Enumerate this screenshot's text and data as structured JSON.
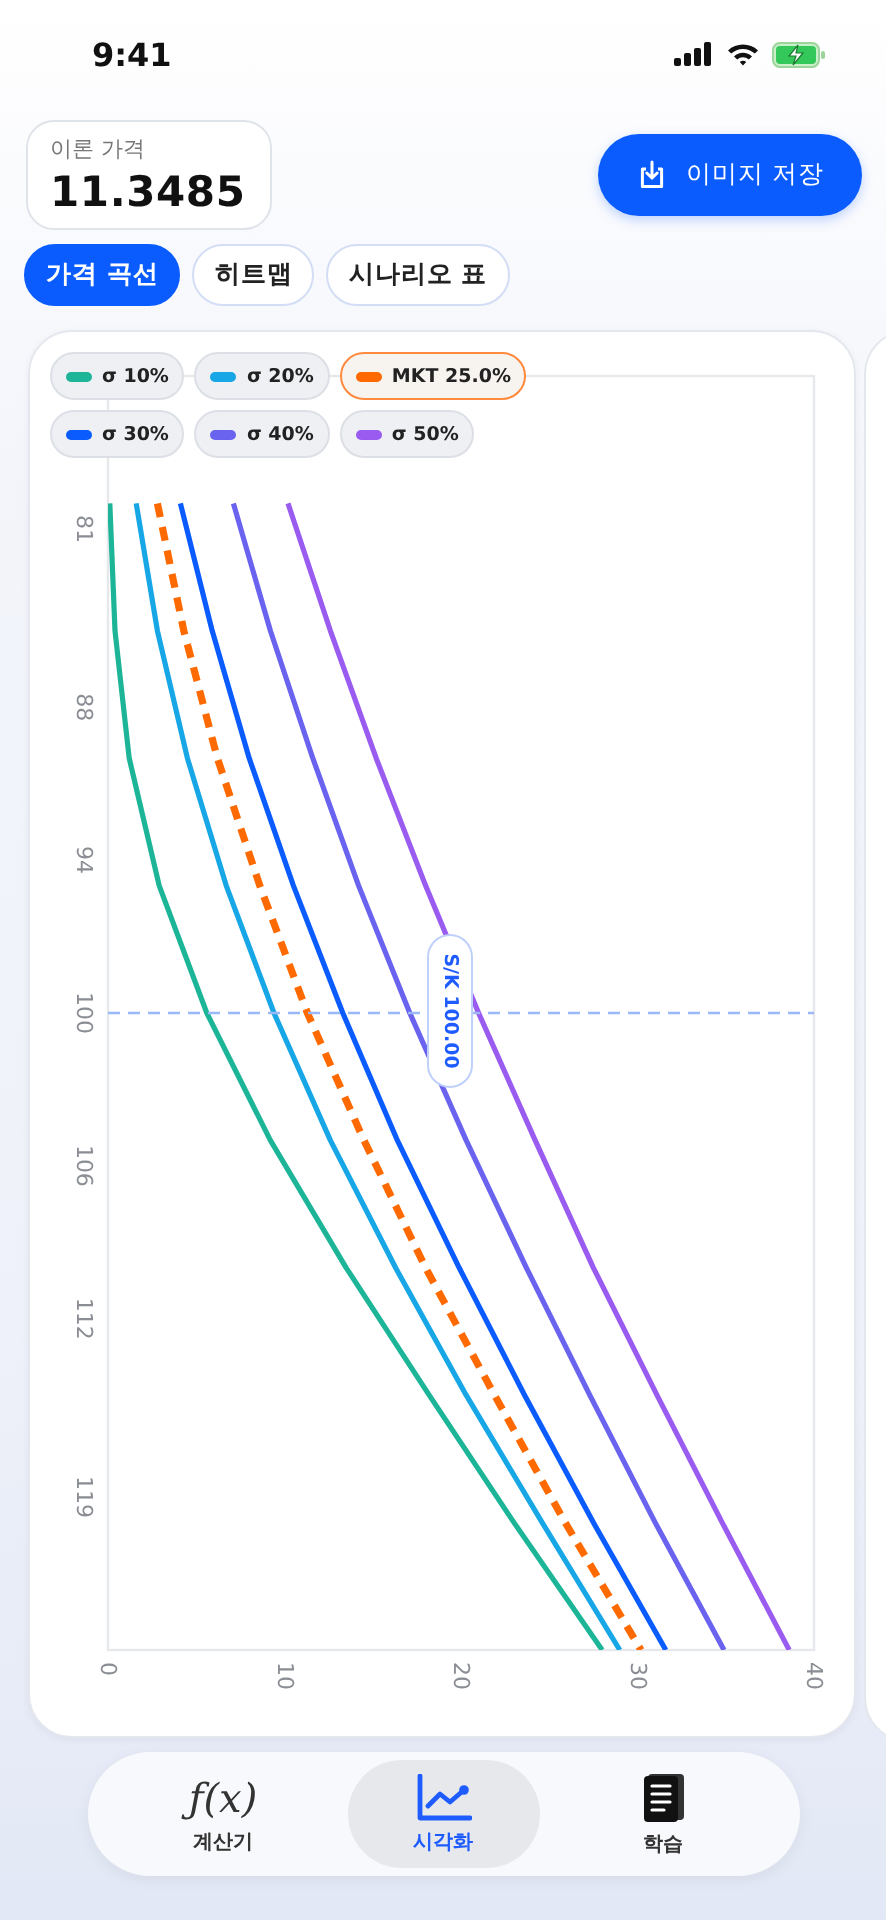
{
  "status_bar": {
    "time": "9:41"
  },
  "price": {
    "label": "이론 가격",
    "value": "11.3485"
  },
  "save_button": {
    "label": "이미지 저장"
  },
  "tabs": [
    {
      "label": "가격 곡선",
      "selected": true
    },
    {
      "label": "히트맵",
      "selected": false
    },
    {
      "label": "시나리오 표",
      "selected": false
    }
  ],
  "legend": [
    {
      "selected": false
    },
    {
      "selected": false
    },
    {
      "selected": true
    },
    {
      "selected": false
    },
    {
      "selected": false
    },
    {
      "selected": false
    }
  ],
  "chart": {
    "chart_data": {
      "type": "line",
      "orientation": "horizontal",
      "x": [
        80,
        85,
        90,
        95,
        100,
        105,
        110,
        115,
        120,
        125
      ],
      "xlim": [
        0,
        40
      ],
      "ylim": [
        125,
        75
      ],
      "xticks": [
        0,
        10,
        20,
        30,
        40
      ],
      "yticks": [
        81,
        88,
        94,
        100,
        106,
        112,
        119
      ],
      "ref_lines": [
        {
          "axis": "y",
          "value": 100,
          "label": "S/K 100.00"
        }
      ],
      "series": [
        {
          "name": "σ 10%",
          "color": "#1db597",
          "values": [
            0.1,
            0.4,
            1.2,
            2.9,
            5.6,
            9.2,
            13.5,
            18.2,
            23,
            28
          ]
        },
        {
          "name": "σ 20%",
          "color": "#17a6e6",
          "values": [
            1.6,
            2.8,
            4.5,
            6.7,
            9.4,
            12.6,
            16.3,
            20.3,
            24.6,
            29
          ]
        },
        {
          "name": "MKT 25.0%",
          "color": "#ff6a00",
          "line_style": "dashed",
          "values": [
            2.8,
            4.3,
            6.2,
            8.6,
            11.3,
            14.5,
            18,
            21.9,
            25.9,
            30.2
          ]
        },
        {
          "name": "σ 30%",
          "color": "#0a5cff",
          "values": [
            4.1,
            5.9,
            8,
            10.5,
            13.3,
            16.4,
            19.9,
            23.6,
            27.5,
            31.6
          ]
        },
        {
          "name": "σ 40%",
          "color": "#6a63f0",
          "values": [
            7.1,
            9.2,
            11.6,
            14.2,
            17.1,
            20.3,
            23.7,
            27.3,
            31,
            34.9
          ]
        },
        {
          "name": "σ 50%",
          "color": "#9a5cf0",
          "values": [
            10.2,
            12.6,
            15.2,
            18,
            21,
            24.2,
            27.5,
            31.1,
            34.8,
            38.6
          ]
        }
      ]
    }
  },
  "bottom_nav": [
    {
      "kind": "glyph",
      "glyph": "ƒ(x)",
      "label": "계산기",
      "selected": false
    },
    {
      "kind": "chart",
      "label": "시각화",
      "selected": true
    },
    {
      "kind": "book",
      "label": "학습",
      "selected": false
    }
  ]
}
